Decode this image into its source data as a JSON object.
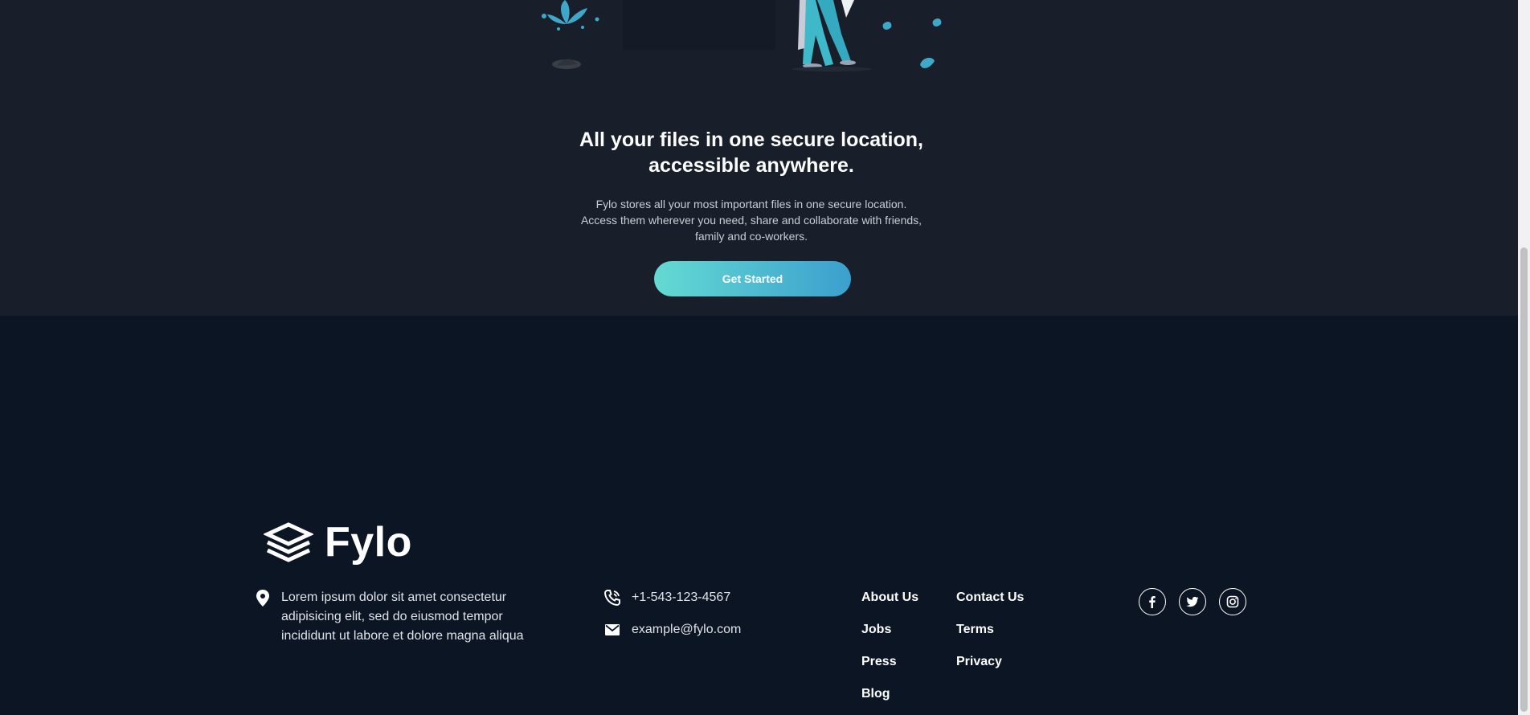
{
  "hero": {
    "headline_line1": "All your files in one secure location,",
    "headline_line2": "accessible anywhere.",
    "subtext_line1": "Fylo stores all your most important files in one secure location.",
    "subtext_line2": "Access them wherever you need, share and collaborate with friends,",
    "subtext_line3": "family and co-workers.",
    "cta_label": "Get Started"
  },
  "footer": {
    "brand": "Fylo",
    "address_line1": "Lorem ipsum dolor sit amet consectetur",
    "address_line2": "adipisicing elit, sed do eiusmod tempor",
    "address_line3": "incididunt ut labore et dolore magna aliqua",
    "phone": "+1-543-123-4567",
    "email": "example@fylo.com",
    "links_col1": [
      "About Us",
      "Jobs",
      "Press",
      "Blog"
    ],
    "links_col2": [
      "Contact Us",
      "Terms",
      "Privacy"
    ],
    "socials": [
      "facebook-icon",
      "twitter-icon",
      "instagram-icon"
    ]
  },
  "colors": {
    "hero_bg": "#181f2a",
    "footer_bg": "#0c1524",
    "accent_start": "#63dad3",
    "accent_end": "#3c9fce"
  }
}
